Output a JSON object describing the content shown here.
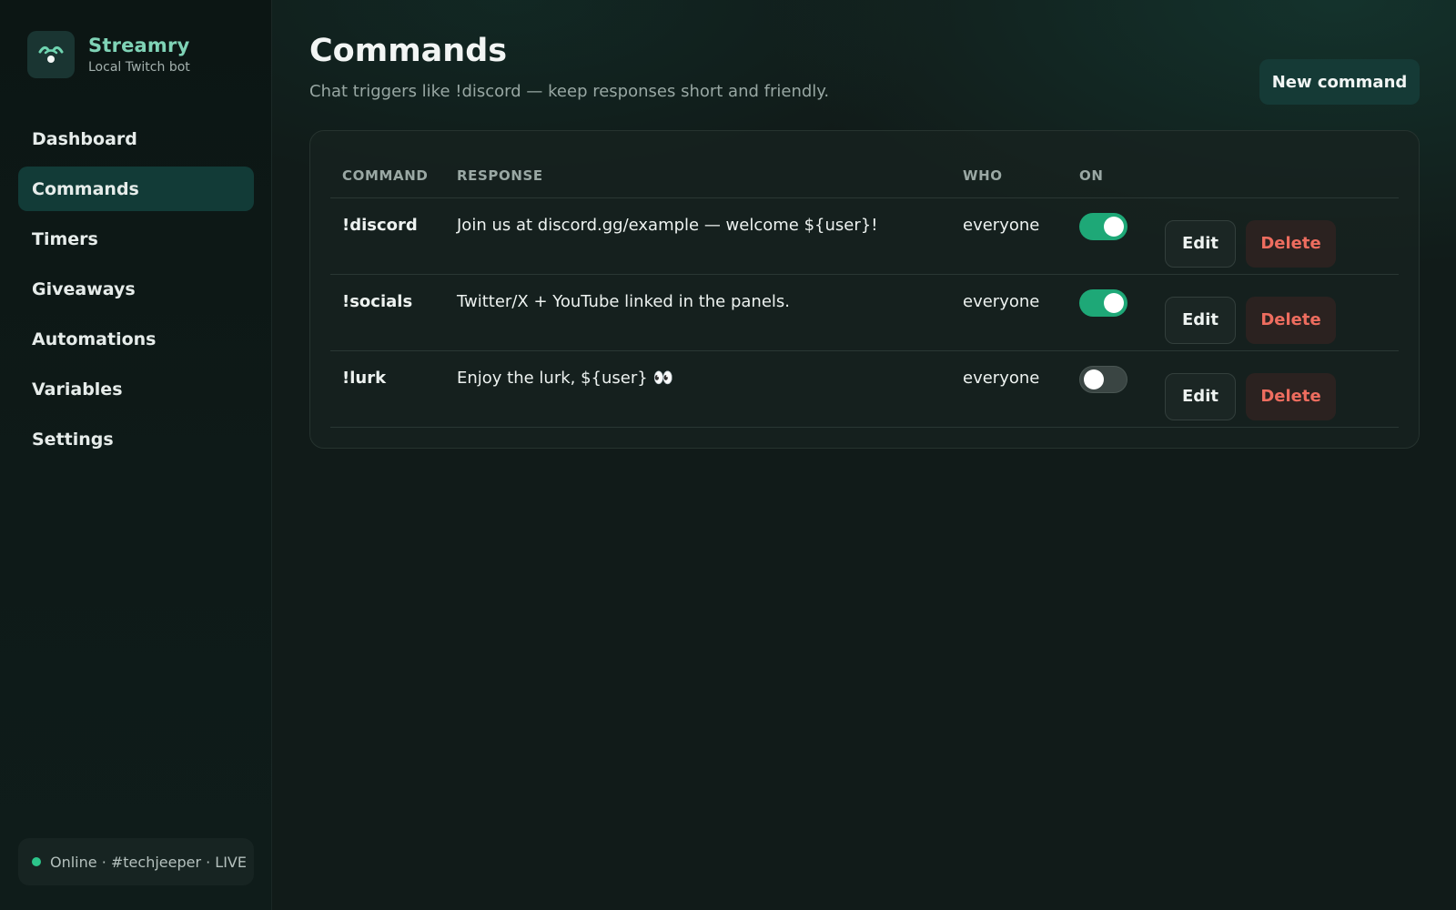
{
  "brand": {
    "name": "Streamry",
    "subtitle": "Local Twitch bot",
    "icon": "bot-logo-icon"
  },
  "sidebar": {
    "items": [
      {
        "label": "Dashboard",
        "active": false
      },
      {
        "label": "Commands",
        "active": true
      },
      {
        "label": "Timers",
        "active": false
      },
      {
        "label": "Giveaways",
        "active": false
      },
      {
        "label": "Automations",
        "active": false
      },
      {
        "label": "Variables",
        "active": false
      },
      {
        "label": "Settings",
        "active": false
      }
    ],
    "status": "Online · #techjeeper · LIVE",
    "status_color": "#2cc58a"
  },
  "page": {
    "title": "Commands",
    "subtitle": "Chat triggers like !discord — keep responses short and friendly.",
    "new_button": "New command"
  },
  "table": {
    "headers": {
      "command": "COMMAND",
      "response": "RESPONSE",
      "who": "WHO",
      "on": "ON"
    },
    "rows": [
      {
        "command": "!discord",
        "response": "Join us at discord.gg/example — welcome ${user}!",
        "who": "everyone",
        "enabled": true,
        "edit": "Edit",
        "delete": "Delete"
      },
      {
        "command": "!socials",
        "response": "Twitter/X + YouTube linked in the panels.",
        "who": "everyone",
        "enabled": true,
        "edit": "Edit",
        "delete": "Delete"
      },
      {
        "command": "!lurk",
        "response": "Enjoy the lurk, ${user} 👀",
        "who": "everyone",
        "enabled": false,
        "edit": "Edit",
        "delete": "Delete"
      }
    ]
  },
  "colors": {
    "accent": "#1ea877",
    "brand_text": "#7fd3b6",
    "danger": "#ee6d5f",
    "active_nav": "#123b37"
  }
}
